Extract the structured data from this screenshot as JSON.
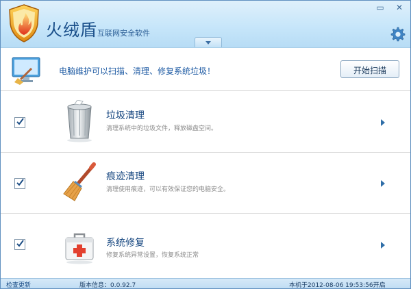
{
  "app": {
    "name": "火绒盾",
    "subtitle": "互联网安全软件"
  },
  "window_controls": {
    "minimize": "▭",
    "close": "✕"
  },
  "banner": {
    "text": "电脑维护可以扫描、清理、修复系统垃圾！",
    "button": "开始扫描"
  },
  "rows": [
    {
      "title": "垃圾清理",
      "desc": "清理系统中的垃圾文件，释放磁盘空间。",
      "checked": true,
      "icon": "trash-can-icon"
    },
    {
      "title": "痕迹清理",
      "desc": "清理使用痕迹，可以有效保证您的电脑安全。",
      "checked": true,
      "icon": "broom-icon"
    },
    {
      "title": "系统修复",
      "desc": "修复系统异常设置，恢复系统正常",
      "checked": true,
      "icon": "first-aid-kit-icon"
    }
  ],
  "status": {
    "update_link": "检查更新",
    "version": "版本信息：0.0.92.7",
    "boot_time": "本机于2012-08-06  19:53:56开启"
  },
  "colors": {
    "accent": "#1d5aa3",
    "header": "#c7e6fa",
    "title": "#14457f"
  }
}
